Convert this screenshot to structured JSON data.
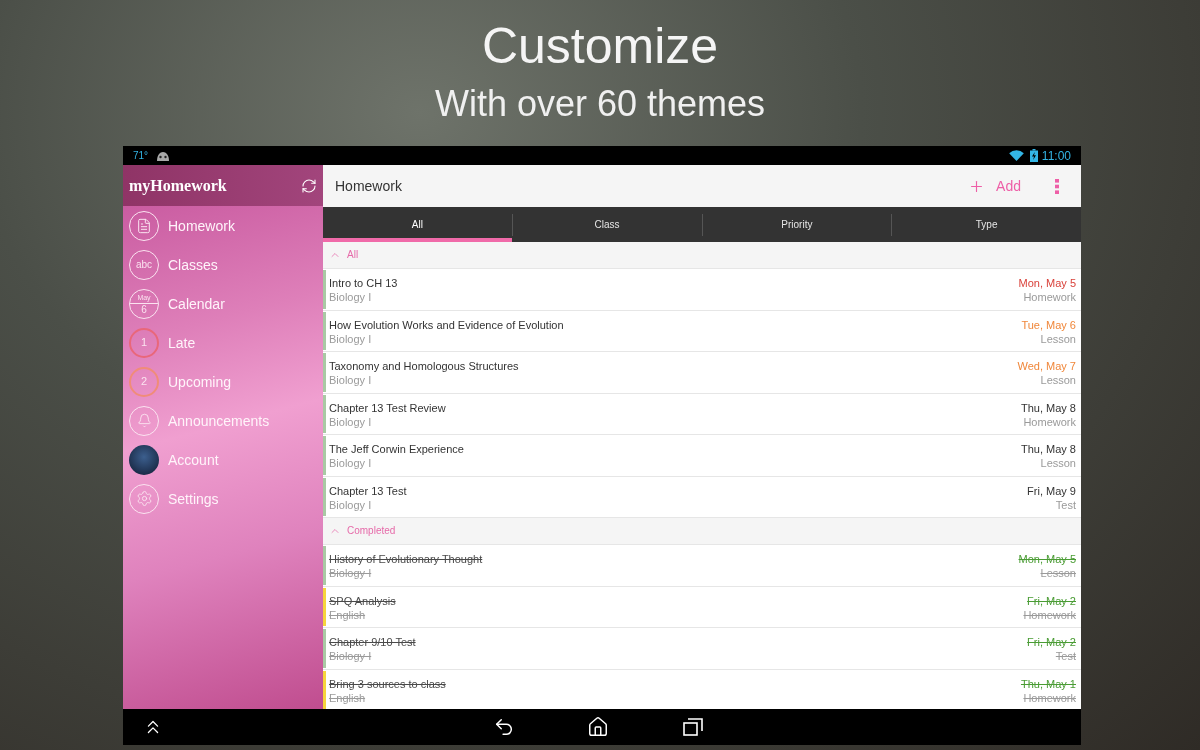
{
  "headline": {
    "title": "Customize",
    "subtitle": "With over 60 themes"
  },
  "status_bar": {
    "temperature": "71°",
    "time": "11:00"
  },
  "sidebar": {
    "logo": "myHomework",
    "items": [
      {
        "label": "Homework",
        "kind": "document"
      },
      {
        "label": "Classes",
        "kind": "text",
        "icon_text": "abc"
      },
      {
        "label": "Calendar",
        "kind": "calendar",
        "month": "May",
        "day": "6"
      },
      {
        "label": "Late",
        "kind": "count",
        "count": "1",
        "color": "#e9677a"
      },
      {
        "label": "Upcoming",
        "kind": "count",
        "count": "2",
        "color": "#f08c78"
      },
      {
        "label": "Announcements",
        "kind": "bell"
      },
      {
        "label": "Account",
        "kind": "avatar"
      },
      {
        "label": "Settings",
        "kind": "gear"
      }
    ]
  },
  "toolbar": {
    "title": "Homework",
    "add_button": "Add"
  },
  "tabs": [
    {
      "label": "All",
      "selected": true
    },
    {
      "label": "Class",
      "selected": false
    },
    {
      "label": "Priority",
      "selected": false
    },
    {
      "label": "Type",
      "selected": false
    }
  ],
  "sections": [
    {
      "title": "All",
      "expanded": true,
      "rows": [
        {
          "title": "Intro to CH 13",
          "class": "Biology I",
          "date": "Mon, May 5",
          "type": "Homework",
          "color": "#a9c9a4",
          "overdue": true,
          "due_soon": false,
          "completed": false
        },
        {
          "title": "How Evolution Works and Evidence of Evolution",
          "class": "Biology I",
          "date": "Tue, May 6",
          "type": "Lesson",
          "color": "#a9c9a4",
          "overdue": false,
          "due_soon": true,
          "completed": false
        },
        {
          "title": "Taxonomy and Homologous Structures",
          "class": "Biology I",
          "date": "Wed, May 7",
          "type": "Lesson",
          "color": "#a9c9a4",
          "overdue": false,
          "due_soon": true,
          "completed": false
        },
        {
          "title": "Chapter 13 Test Review",
          "class": "Biology I",
          "date": "Thu, May 8",
          "type": "Homework",
          "color": "#a9c9a4",
          "overdue": false,
          "due_soon": false,
          "completed": false
        },
        {
          "title": "The Jeff Corwin Experience",
          "class": "Biology I",
          "date": "Thu, May 8",
          "type": "Lesson",
          "color": "#a9c9a4",
          "overdue": false,
          "due_soon": false,
          "completed": false
        },
        {
          "title": "Chapter 13 Test",
          "class": "Biology I",
          "date": "Fri, May 9",
          "type": "Test",
          "color": "#a9c9a4",
          "overdue": false,
          "due_soon": false,
          "completed": false
        }
      ]
    },
    {
      "title": "Completed",
      "expanded": true,
      "rows": [
        {
          "title": "History of Evolutionary Thought",
          "class": "Biology I",
          "date": "Mon, May 5",
          "type": "Lesson",
          "color": "#a9c9a4",
          "overdue": false,
          "due_soon": false,
          "completed": true
        },
        {
          "title": "SPQ Analysis",
          "class": "English",
          "date": "Fri, May 2",
          "type": "Homework",
          "color": "#f6d43c",
          "overdue": false,
          "due_soon": false,
          "completed": true
        },
        {
          "title": "Chapter 9/10 Test",
          "class": "Biology I",
          "date": "Fri, May 2",
          "type": "Test",
          "color": "#a9c9a4",
          "overdue": false,
          "due_soon": false,
          "completed": true
        },
        {
          "title": "Bring 3 sources to class",
          "class": "English",
          "date": "Thu, May 1",
          "type": "Homework",
          "color": "#f6d43c",
          "overdue": false,
          "due_soon": false,
          "completed": true
        }
      ]
    }
  ]
}
